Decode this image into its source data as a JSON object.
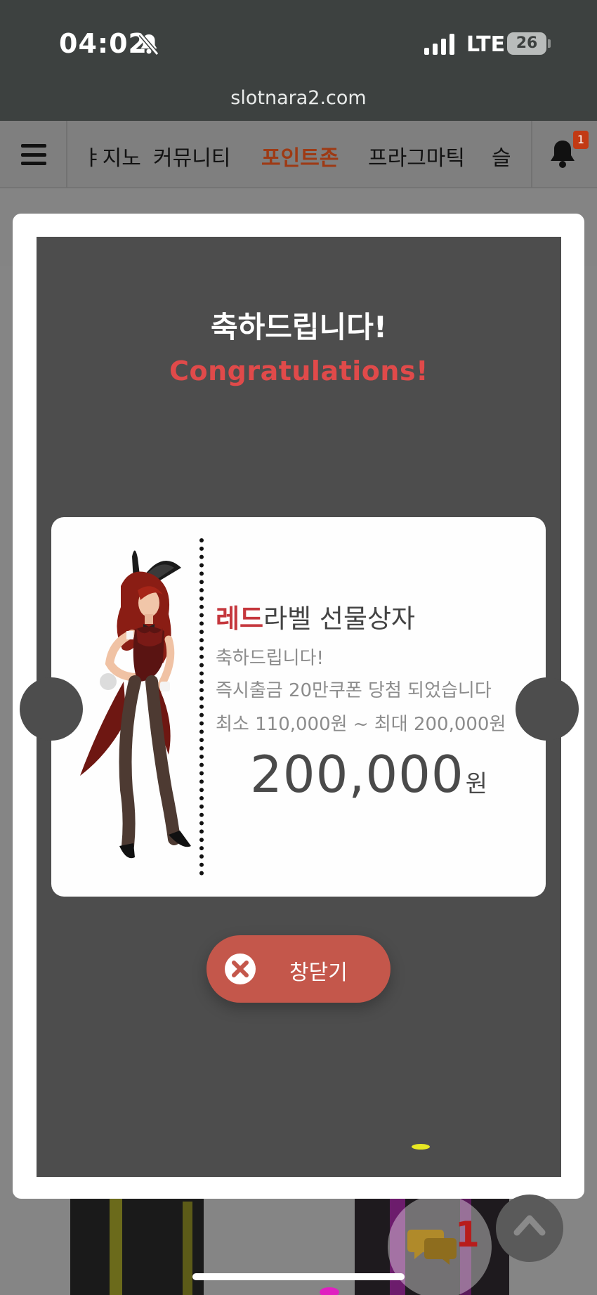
{
  "status_bar": {
    "time": "04:02",
    "network": "LTE",
    "battery": "26",
    "icons": [
      "bell-muted-icon",
      "signal-icon"
    ]
  },
  "browser": {
    "url": "slotnara2.com"
  },
  "site_nav": {
    "items": [
      {
        "label": "ㅑ지노"
      },
      {
        "label": "커뮤니티"
      },
      {
        "label": "포인트존",
        "active": true
      },
      {
        "label": "프라그마틱"
      },
      {
        "label": "슬"
      }
    ],
    "notification_count": "1"
  },
  "modal": {
    "title_ko": "축하드립니다!",
    "title_en": "Congratulations!",
    "prize": {
      "name_accent": "레드",
      "name_rest": "라벨 선물상자",
      "line1": "축하드립니다!",
      "line2": "즉시출금 20만쿠폰 당첨 되었습니다",
      "line3": "최소 110,000원 ~ 최대 200,000원",
      "amount": "200,000",
      "unit": "원"
    },
    "close_label": "창닫기"
  },
  "floating": {
    "chat_count": "1"
  },
  "colors": {
    "accent_red": "#c5373d",
    "title_red": "#e04a4a",
    "close_button": "#c4574b",
    "active_nav": "#9e3a14"
  }
}
